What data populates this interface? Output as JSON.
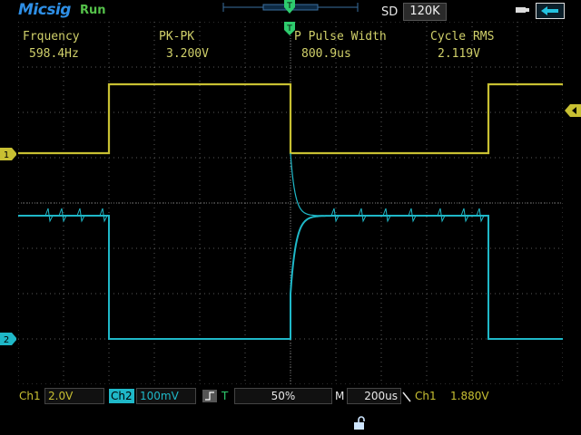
{
  "header": {
    "brand": "Micsig",
    "run_state": "Run",
    "sd_label": "SD",
    "memory_depth": "120K"
  },
  "measurements": [
    {
      "label": "Frquency",
      "value": "598.4Hz"
    },
    {
      "label": "PK-PK",
      "value": "3.200V"
    },
    {
      "label": "P Pulse Width",
      "value": "800.9us"
    },
    {
      "label": "Cycle RMS",
      "value": "2.119V"
    }
  ],
  "markers": {
    "ch1": "1",
    "ch2": "2",
    "trigger": "T"
  },
  "footer": {
    "ch1_label": "Ch1",
    "ch1_scale": "2.0V",
    "ch2_label": "Ch2",
    "ch2_scale": "100mV",
    "trigger_mode": "T",
    "trigger_position": "50%",
    "timebase_label": "M",
    "timebase": "200us",
    "trigger_source": "Ch1",
    "trigger_level": "1.880V"
  },
  "colors": {
    "ch1": "#c8c032",
    "ch2": "#1fb8c8",
    "trigger": "#2ecc6e",
    "brand": "#2e8fe6"
  }
}
